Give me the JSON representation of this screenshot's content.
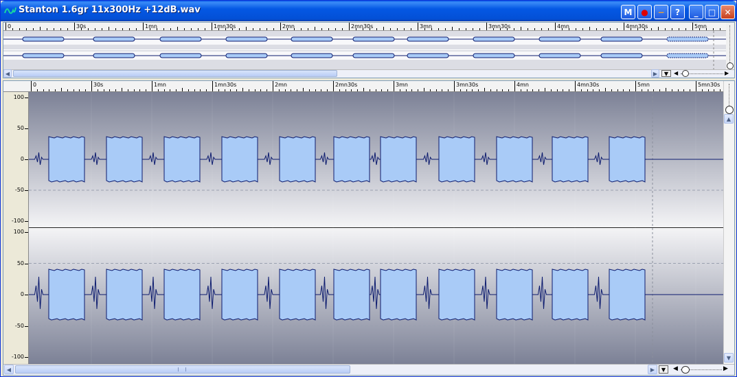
{
  "window": {
    "title": "Stanton 1.6gr 11x300Hz +12dB.wav",
    "buttons": {
      "marker": "M",
      "record": "●",
      "minus": "−",
      "help": "?",
      "minimize": "_",
      "maximize": "□",
      "close": "✕"
    }
  },
  "overview": {
    "ruler_labels": [
      "0",
      "30s",
      "1mn",
      "1mn30s",
      "2mn",
      "2mn30s",
      "3mn",
      "3mn30s",
      "4mn",
      "4mn30s",
      "5mn"
    ]
  },
  "main": {
    "ruler_labels": [
      "0",
      "30s",
      "1mn",
      "1mn30s",
      "2mn",
      "2mn30s",
      "3mn",
      "3mn30s",
      "4mn",
      "4mn30s",
      "5mn",
      "5mn30s"
    ],
    "channel_top_y_labels": [
      "100",
      "50",
      "0",
      "-50",
      "-100"
    ],
    "channel_bottom_y_labels": [
      "100",
      "50",
      "0",
      "-50",
      "-100"
    ]
  },
  "colors": {
    "waveform_fill": "#a9cbf7",
    "waveform_stroke": "#0b1a6e",
    "title_bar": "#0458e4",
    "background_dark": "#7c8196",
    "background_light": "#f4f4f6"
  },
  "icons": {
    "app": "waveform-icon",
    "scroll_left": "arrow-left-icon",
    "scroll_right": "arrow-right-icon",
    "scroll_up": "arrow-up-icon",
    "scroll_down": "arrow-down-icon",
    "dropdown": "triangle-down-icon"
  }
}
